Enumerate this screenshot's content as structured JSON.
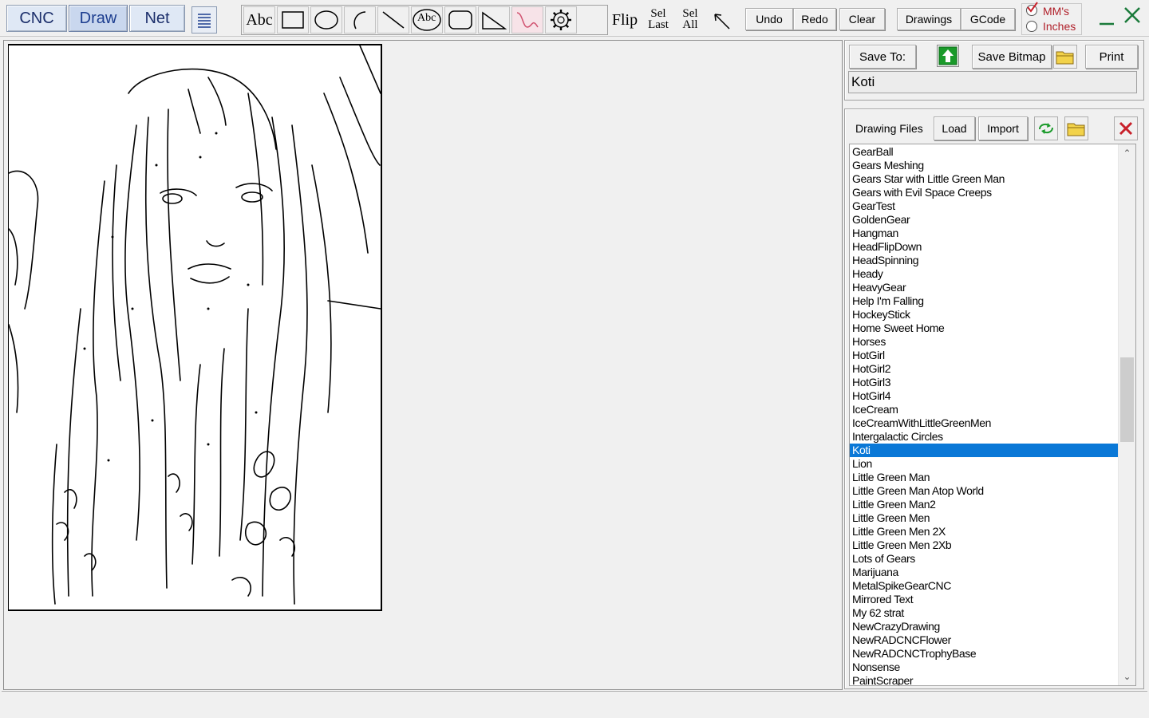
{
  "modes": {
    "cnc": "CNC",
    "draw": "Draw",
    "net": "Net"
  },
  "tools": {
    "text": "Abc",
    "circle_text": "Abc",
    "flip": "Flip",
    "sel_last_top": "Sel",
    "sel_last_bottom": "Last",
    "sel_all_top": "Sel",
    "sel_all_bottom": "All"
  },
  "actions": {
    "undo": "Undo",
    "redo": "Redo",
    "clear": "Clear",
    "drawings": "Drawings",
    "gcode": "GCode"
  },
  "units": {
    "mm": "MM's",
    "inches": "Inches",
    "selected": "mm"
  },
  "save": {
    "save_to": "Save To:",
    "save_bitmap": "Save Bitmap",
    "print": "Print",
    "filename": "Koti"
  },
  "files": {
    "label": "Drawing Files",
    "load": "Load",
    "import": "Import",
    "items": [
      "GearBall",
      "Gears Meshing",
      "Gears Star with Little Green Man",
      "Gears with Evil Space Creeps",
      "GearTest",
      "GoldenGear",
      "Hangman",
      "HeadFlipDown",
      "HeadSpinning",
      "Heady",
      "HeavyGear",
      "Help I'm Falling",
      "HockeyStick",
      "Home Sweet Home",
      "Horses",
      "HotGirl",
      "HotGirl2",
      "HotGirl3",
      "HotGirl4",
      "IceCream",
      "IceCreamWithLittleGreenMen",
      "Intergalactic Circles",
      "Koti",
      "Lion",
      "Little Green Man",
      "Little Green Man Atop World",
      "Little Green Man2",
      "Little Green Men",
      "Little Green Men 2X",
      "Little Green Men 2Xb",
      "Lots of Gears",
      "Marijuana",
      "MetalSpikeGearCNC",
      "Mirrored Text",
      "My 62 strat",
      "NewCrazyDrawing",
      "NewRADCNCFlower",
      "NewRADCNCTrophyBase",
      "Nonsense",
      "PaintScraper"
    ],
    "selected": "Koti"
  },
  "colors": {
    "selection": "#0a78d7",
    "accent_green": "#1a9a2a",
    "close_red": "#c8202a"
  }
}
